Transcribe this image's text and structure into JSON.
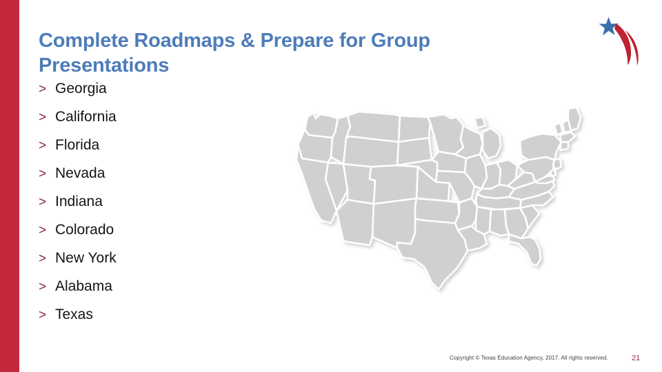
{
  "slide": {
    "accent_bar_color": "#c4283a",
    "background_color": "#ffffff"
  },
  "title": {
    "text": "Complete Roadmaps & Prepare for Group Presentations",
    "color": "#4e7cb8"
  },
  "bullets": {
    "marker": ">",
    "marker_color": "#8a2641",
    "text_color": "#141414",
    "items": [
      {
        "label": "Georgia"
      },
      {
        "label": "California"
      },
      {
        "label": "Florida"
      },
      {
        "label": "Nevada"
      },
      {
        "label": "Indiana"
      },
      {
        "label": "Colorado"
      },
      {
        "label": "New York"
      },
      {
        "label": "Alabama"
      },
      {
        "label": "Texas"
      }
    ]
  },
  "map": {
    "name": "united-states-map",
    "fill_color": "#d0d0d0",
    "border_color": "#ffffff"
  },
  "logo": {
    "name": "texas-education-agency-logo",
    "star_color": "#3a6ea8",
    "swoosh_color": "#bd2333"
  },
  "footer": {
    "copyright": "Copyright © Texas Education Agency, 2017. All rights reserved.",
    "page_number": "21",
    "page_number_color": "#9a3040"
  }
}
